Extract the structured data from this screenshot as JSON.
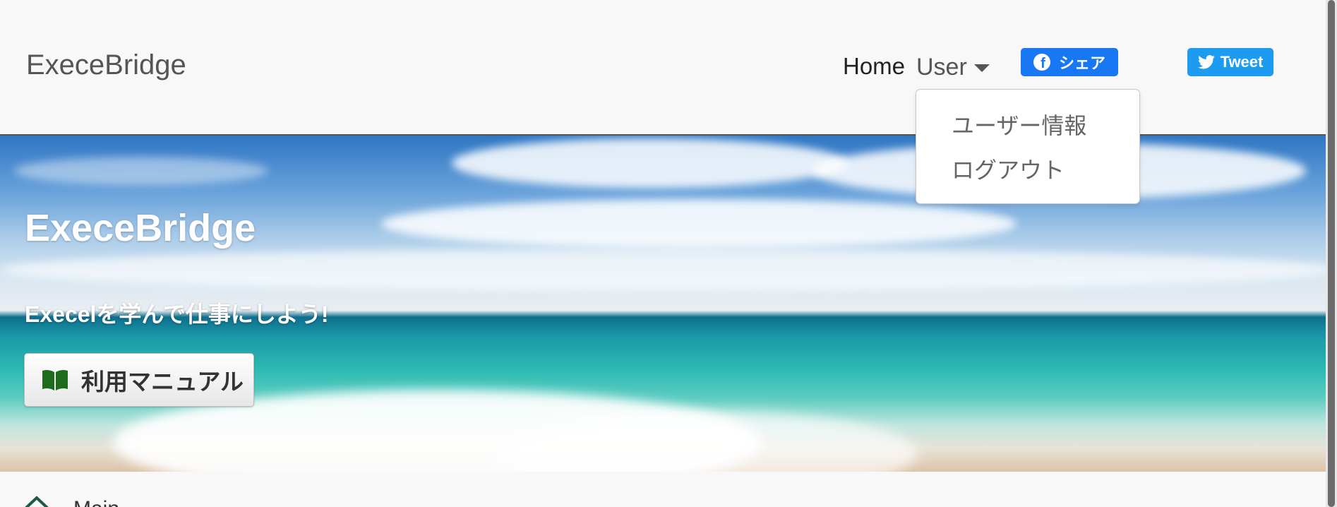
{
  "navbar": {
    "brand": "ExeceBridge",
    "home": "Home",
    "user": "User",
    "fb_share": "シェア",
    "tweet": "Tweet"
  },
  "user_menu": {
    "items": [
      "ユーザー情報",
      "ログアウト"
    ]
  },
  "hero": {
    "title": "ExeceBridge",
    "subtitle": "Execelを学んで仕事にしよう!",
    "manual_button": "利用マニュアル"
  },
  "section": {
    "label": "Main"
  },
  "colors": {
    "facebook": "#1877f2",
    "twitter": "#1d9bf0",
    "book_icon": "#1e6b1e"
  },
  "icons": {
    "fb": "facebook-icon",
    "tw": "twitter-bird-icon",
    "manual": "open-book-icon",
    "section": "home-icon"
  }
}
